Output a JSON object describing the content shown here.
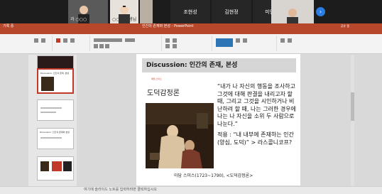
{
  "participants": {
    "tiles": [
      {
        "label": "과 ○○○"
      },
      {
        "label": "○○○ 선생님"
      },
      {
        "label": ""
      }
    ],
    "names": [
      "조현성",
      "김현정",
      "미영 정"
    ],
    "right_tile_label": "○○○"
  },
  "window": {
    "left_label": "기록 중",
    "title": "인간의 존재와 본성 - PowerPoint",
    "right_label": "공유 중"
  },
  "slide": {
    "title": "Discussion: 인간의 존재, 본성",
    "book_subtitle": "애덤 스미스",
    "book_title": "도덕감정론",
    "quote_lines": "“내가 나 자신의 행동을 조사하고 그것에 대해 판결을 내리고자 할 때, 그리고 그것을 시인하거나 비난하려 할 때, 나는 그러한 경우에 나는 나 자신을 소위 두 사람으로 나눈다.”",
    "apply_label": "적용 : “내 내부에 존재하는 인간(양심, 도덕)” > 라스콜니코프?",
    "caption": "아담 스미스(1723~1790), <도덕감정론>"
  },
  "thumbnails": [
    {
      "num": "",
      "title": ""
    },
    {
      "num": "",
      "title": "Discussion: 인간의 존재, 본성"
    },
    {
      "num": "",
      "title": ""
    },
    {
      "num": "",
      "title": "Discussion: 인간의 존재와 본성"
    },
    {
      "num": "",
      "title": ""
    }
  ],
  "status": {
    "text": "여기에 슬라이드 노트를 입력하려면 클릭하십시오"
  },
  "colors": {
    "accent": "#b7472a",
    "selected": "#c0392b"
  }
}
